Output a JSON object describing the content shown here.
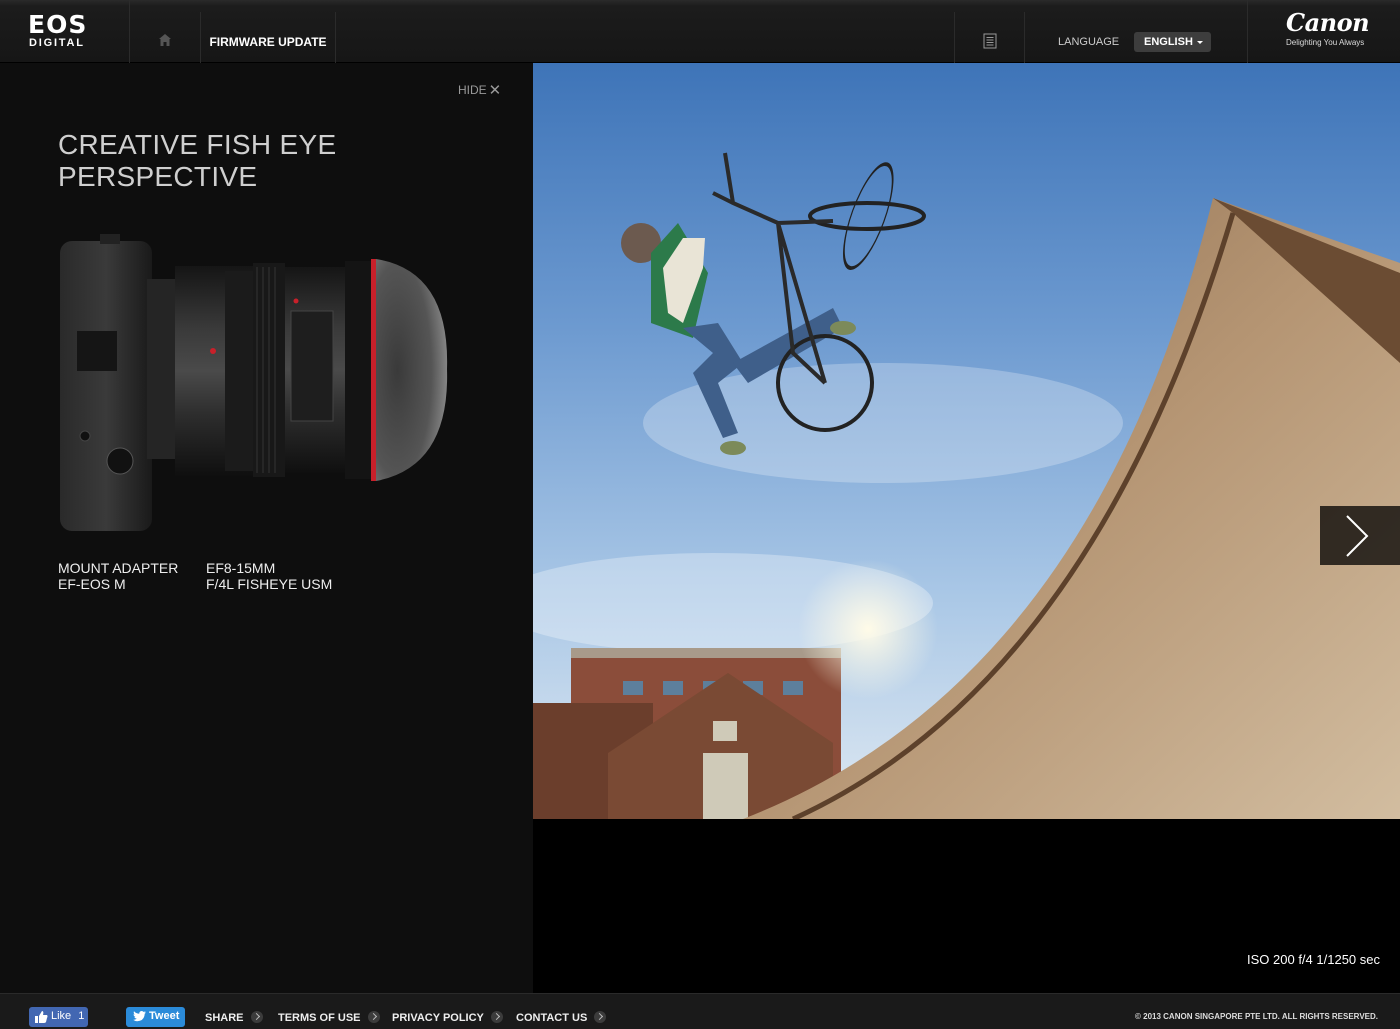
{
  "header": {
    "logo_top": "EOS",
    "logo_bottom": "DIGITAL",
    "home_icon": "home-icon",
    "nav_firmware": "FIRMWARE UPDATE",
    "doc_icon": "document-icon",
    "language_label": "LANGUAGE",
    "language_value": "ENGLISH",
    "brand": "Canon",
    "tagline": "Delighting You Always"
  },
  "panel": {
    "hide_label": "HIDE",
    "title": "CREATIVE FISH EYE PERSPECTIVE",
    "products": [
      {
        "line1": "MOUNT ADAPTER",
        "line2": "EF-EOS M"
      },
      {
        "line1": "EF8-15MM",
        "line2": "F/4L FISHEYE USM"
      }
    ]
  },
  "photo": {
    "exif": "ISO 200 f/4 1/1250 sec",
    "next_icon": "chevron-right-icon"
  },
  "footer": {
    "like_label": "Like",
    "like_count": "1",
    "tweet_label": "Tweet",
    "links": [
      "SHARE",
      "TERMS OF USE",
      "PRIVACY POLICY",
      "CONTACT US"
    ],
    "copyright": "© 2013 CANON SINGAPORE PTE LTD. ALL RIGHTS RESERVED."
  },
  "colors": {
    "header_bg": "#161616",
    "panel_bg": "#0e0e0e",
    "facebook": "#4267b2",
    "twitter": "#2b8bd9",
    "lens_ring": "#c8202a"
  }
}
